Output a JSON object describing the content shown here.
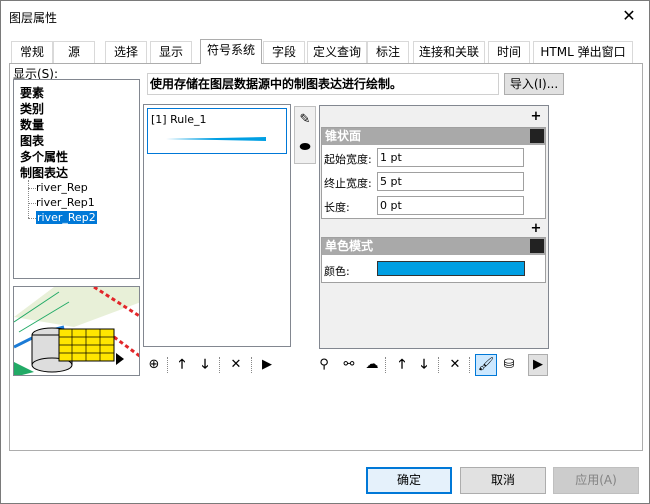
{
  "window": {
    "title": "图层属性"
  },
  "tabs": [
    {
      "label": "常规"
    },
    {
      "label": "源"
    },
    {
      "label": "选择"
    },
    {
      "label": "显示"
    },
    {
      "label": "符号系统"
    },
    {
      "label": "字段"
    },
    {
      "label": "定义查询"
    },
    {
      "label": "标注"
    },
    {
      "label": "连接和关联"
    },
    {
      "label": "时间"
    },
    {
      "label": "HTML 弹出窗口"
    }
  ],
  "show_label": "显示(S):",
  "tree": {
    "items": [
      "要素",
      "类别",
      "数量",
      "图表",
      "多个属性",
      "制图表达"
    ],
    "children": [
      "river_Rep",
      "river_Rep1",
      "river_Rep2"
    ],
    "selected_child": "river_Rep2"
  },
  "description": "使用存储在图层数据源中的制图表达进行绘制。",
  "import_button": "导入(I)...",
  "rules": [
    {
      "label": "[1] Rule_1"
    }
  ],
  "groups": {
    "taper": {
      "title": "锥状面",
      "fields": [
        {
          "label": "起始宽度:",
          "value": "1 pt"
        },
        {
          "label": "终止宽度:",
          "value": "5 pt"
        },
        {
          "label": "长度:",
          "value": "0 pt"
        }
      ]
    },
    "solid": {
      "title": "单色模式",
      "color_label": "颜色:",
      "color_value": "#009fe3"
    }
  },
  "buttons": {
    "ok": "确定",
    "cancel": "取消",
    "apply": "应用(A)"
  },
  "icons": {
    "close": "close-icon",
    "add_rule": "add-icon",
    "move_up": "arrow-up-icon",
    "move_down": "arrow-down-icon",
    "remove": "delete-icon",
    "more": "play-icon"
  }
}
